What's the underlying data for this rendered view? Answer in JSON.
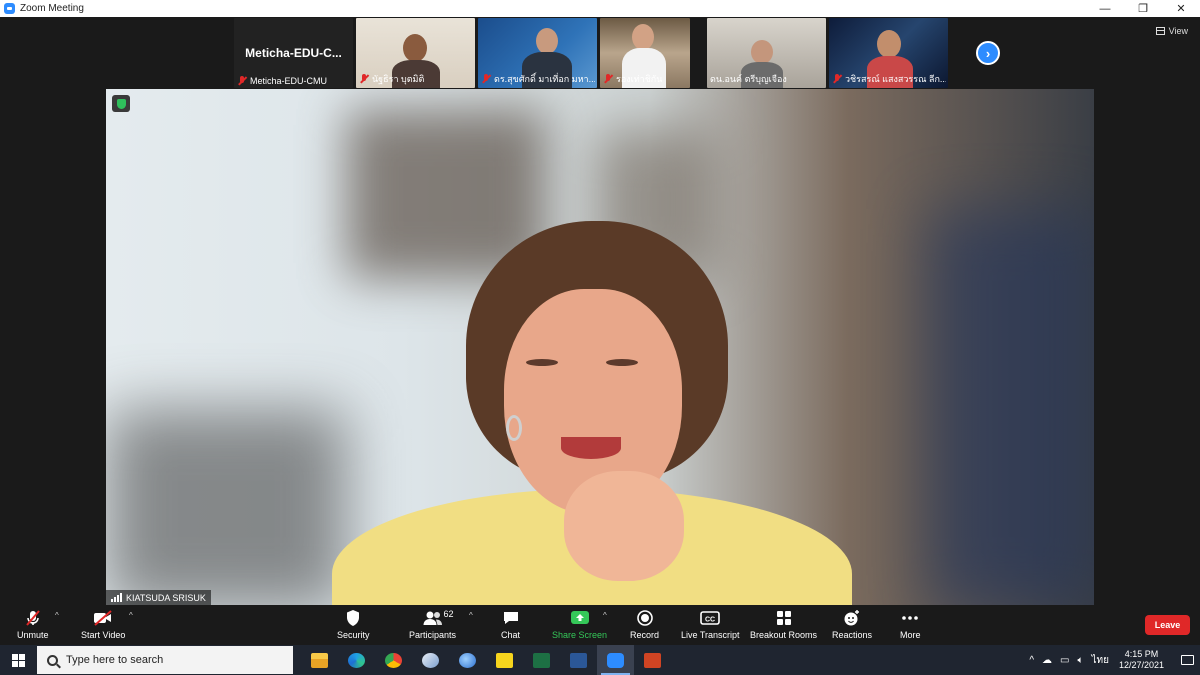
{
  "window": {
    "title": "Zoom Meeting",
    "controls": [
      "—",
      "❐",
      "✕"
    ]
  },
  "view": {
    "label": "View"
  },
  "thumbnails": [
    {
      "name": "Meticha-EDU-CMU",
      "display_name": "Meticha-EDU-C...",
      "muted": true,
      "video": false
    },
    {
      "name": "นัฐธิรา บุตมิติ",
      "muted": true,
      "video": true
    },
    {
      "name": "ดร.สุขศักดิ์ มาเที่อก มหา...",
      "muted": true,
      "video": true
    },
    {
      "name": "รองเท่าชิกัน",
      "muted": true,
      "video": true
    },
    {
      "name": "ดน.อนค์ ตรีบุญเจือง",
      "muted": false,
      "video": true
    },
    {
      "name": "วชิรสรณ์ แสงสวรรณ ลีก...",
      "muted": true,
      "video": true
    }
  ],
  "main_video": {
    "speaker": "KIATSUDA SRISUK"
  },
  "toolbar": {
    "unmute": "Unmute",
    "start_video": "Start Video",
    "security": "Security",
    "participants": "Participants",
    "participants_count": "62",
    "chat": "Chat",
    "share_screen": "Share Screen",
    "record": "Record",
    "live_transcript": "Live Transcript",
    "breakout_rooms": "Breakout Rooms",
    "reactions": "Reactions",
    "more": "More",
    "leave": "Leave",
    "cc": "CC"
  },
  "taskbar": {
    "search_placeholder": "Type here to search",
    "apps": [
      "file-explorer",
      "edge",
      "chrome",
      "app-bird",
      "globe",
      "sticky-notes",
      "excel",
      "word",
      "zoom",
      "powerpoint"
    ],
    "language": "ไทย",
    "time": "4:15 PM",
    "date": "12/27/2021"
  },
  "colors": {
    "accent": "#2d8cff",
    "leave": "#e02828",
    "share": "#35c759",
    "muted": "#e02828"
  }
}
